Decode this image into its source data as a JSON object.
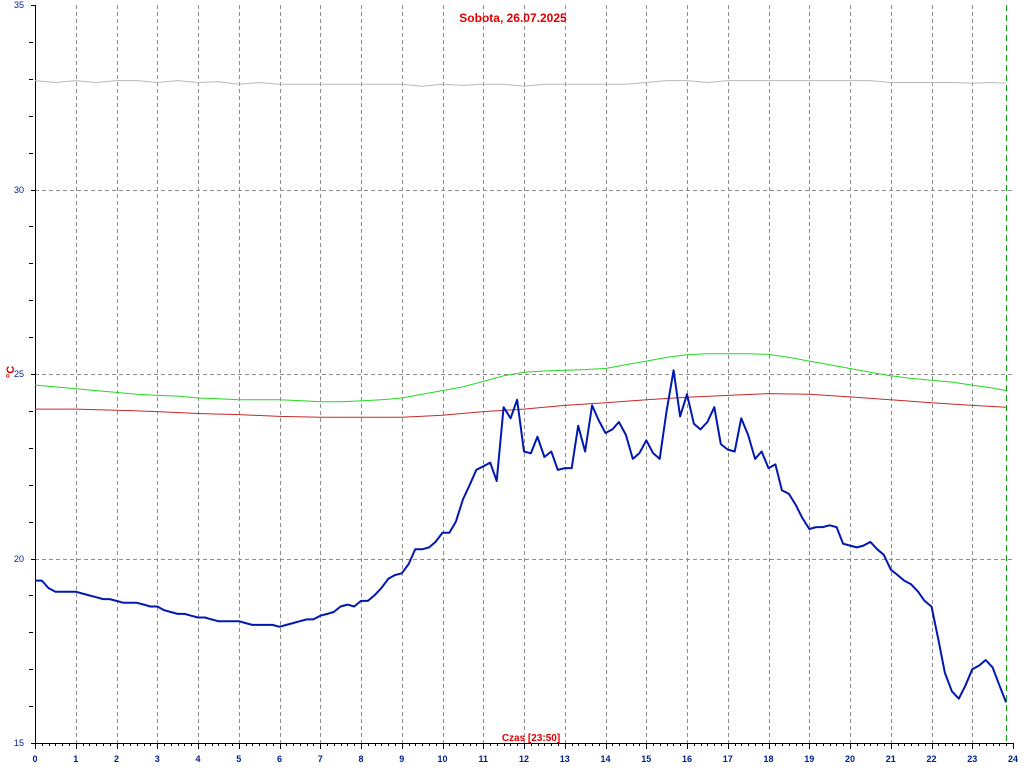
{
  "chart_data": {
    "type": "line",
    "title": "Sobota, 26.07.2025",
    "xlabel": "Czas [23:50]",
    "ylabel": "°C",
    "xlim": [
      0,
      24
    ],
    "ylim": [
      15,
      35
    ],
    "xticks": [
      0,
      1,
      2,
      3,
      4,
      5,
      6,
      7,
      8,
      9,
      10,
      11,
      12,
      13,
      14,
      15,
      16,
      17,
      18,
      19,
      20,
      21,
      22,
      23,
      24
    ],
    "yticks": [
      15,
      20,
      25,
      30,
      35
    ],
    "grid": true,
    "colors": {
      "blue": "#0018b0",
      "green": "#22d822",
      "red": "#c82828",
      "gray": "#b8b8b8",
      "now_line": "#00a000",
      "title": "#e00000",
      "ticks": "#00208a",
      "grid": "#8c8c8c"
    },
    "current_time_hours": 23.83,
    "series": [
      {
        "color": "#0018b0",
        "points": [
          [
            0,
            19.4
          ],
          [
            0.17,
            19.4
          ],
          [
            0.33,
            19.2
          ],
          [
            0.5,
            19.1
          ],
          [
            0.67,
            19.1
          ],
          [
            0.83,
            19.1
          ],
          [
            1,
            19.1
          ],
          [
            1.17,
            19.05
          ],
          [
            1.33,
            19.0
          ],
          [
            1.5,
            18.95
          ],
          [
            1.67,
            18.9
          ],
          [
            1.83,
            18.9
          ],
          [
            2,
            18.85
          ],
          [
            2.17,
            18.8
          ],
          [
            2.33,
            18.8
          ],
          [
            2.5,
            18.8
          ],
          [
            2.67,
            18.75
          ],
          [
            2.83,
            18.7
          ],
          [
            3,
            18.7
          ],
          [
            3.17,
            18.6
          ],
          [
            3.33,
            18.55
          ],
          [
            3.5,
            18.5
          ],
          [
            3.67,
            18.5
          ],
          [
            3.83,
            18.45
          ],
          [
            4,
            18.4
          ],
          [
            4.17,
            18.4
          ],
          [
            4.33,
            18.35
          ],
          [
            4.5,
            18.3
          ],
          [
            4.67,
            18.3
          ],
          [
            4.83,
            18.3
          ],
          [
            5,
            18.3
          ],
          [
            5.17,
            18.25
          ],
          [
            5.33,
            18.2
          ],
          [
            5.5,
            18.2
          ],
          [
            5.67,
            18.2
          ],
          [
            5.83,
            18.2
          ],
          [
            6,
            18.15
          ],
          [
            6.17,
            18.2
          ],
          [
            6.33,
            18.25
          ],
          [
            6.5,
            18.3
          ],
          [
            6.67,
            18.35
          ],
          [
            6.83,
            18.35
          ],
          [
            7,
            18.45
          ],
          [
            7.17,
            18.5
          ],
          [
            7.33,
            18.55
          ],
          [
            7.5,
            18.7
          ],
          [
            7.67,
            18.75
          ],
          [
            7.83,
            18.7
          ],
          [
            8,
            18.85
          ],
          [
            8.17,
            18.85
          ],
          [
            8.33,
            19.0
          ],
          [
            8.5,
            19.2
          ],
          [
            8.67,
            19.45
          ],
          [
            8.83,
            19.55
          ],
          [
            9,
            19.6
          ],
          [
            9.17,
            19.85
          ],
          [
            9.33,
            20.25
          ],
          [
            9.5,
            20.25
          ],
          [
            9.67,
            20.3
          ],
          [
            9.83,
            20.45
          ],
          [
            10,
            20.7
          ],
          [
            10.17,
            20.7
          ],
          [
            10.33,
            21.0
          ],
          [
            10.5,
            21.6
          ],
          [
            10.67,
            22.0
          ],
          [
            10.83,
            22.4
          ],
          [
            11,
            22.5
          ],
          [
            11.17,
            22.6
          ],
          [
            11.33,
            22.1
          ],
          [
            11.5,
            24.1
          ],
          [
            11.67,
            23.8
          ],
          [
            11.83,
            24.3
          ],
          [
            12,
            22.9
          ],
          [
            12.17,
            22.85
          ],
          [
            12.33,
            23.3
          ],
          [
            12.5,
            22.75
          ],
          [
            12.67,
            22.9
          ],
          [
            12.83,
            22.4
          ],
          [
            13,
            22.45
          ],
          [
            13.17,
            22.45
          ],
          [
            13.33,
            23.6
          ],
          [
            13.5,
            22.9
          ],
          [
            13.67,
            24.15
          ],
          [
            13.83,
            23.75
          ],
          [
            14,
            23.4
          ],
          [
            14.17,
            23.5
          ],
          [
            14.33,
            23.7
          ],
          [
            14.5,
            23.35
          ],
          [
            14.67,
            22.7
          ],
          [
            14.83,
            22.85
          ],
          [
            15,
            23.2
          ],
          [
            15.17,
            22.85
          ],
          [
            15.33,
            22.7
          ],
          [
            15.5,
            24.0
          ],
          [
            15.67,
            25.1
          ],
          [
            15.83,
            23.85
          ],
          [
            16,
            24.45
          ],
          [
            16.17,
            23.65
          ],
          [
            16.33,
            23.5
          ],
          [
            16.5,
            23.7
          ],
          [
            16.67,
            24.1
          ],
          [
            16.83,
            23.1
          ],
          [
            17,
            22.95
          ],
          [
            17.17,
            22.9
          ],
          [
            17.33,
            23.8
          ],
          [
            17.5,
            23.35
          ],
          [
            17.67,
            22.7
          ],
          [
            17.83,
            22.9
          ],
          [
            18,
            22.45
          ],
          [
            18.17,
            22.55
          ],
          [
            18.33,
            21.85
          ],
          [
            18.5,
            21.75
          ],
          [
            18.67,
            21.45
          ],
          [
            18.83,
            21.1
          ],
          [
            19,
            20.8
          ],
          [
            19.17,
            20.85
          ],
          [
            19.33,
            20.85
          ],
          [
            19.5,
            20.9
          ],
          [
            19.67,
            20.85
          ],
          [
            19.83,
            20.4
          ],
          [
            20,
            20.35
          ],
          [
            20.17,
            20.3
          ],
          [
            20.33,
            20.35
          ],
          [
            20.5,
            20.45
          ],
          [
            20.67,
            20.25
          ],
          [
            20.83,
            20.1
          ],
          [
            21,
            19.7
          ],
          [
            21.17,
            19.55
          ],
          [
            21.33,
            19.4
          ],
          [
            21.5,
            19.3
          ],
          [
            21.67,
            19.1
          ],
          [
            21.83,
            18.85
          ],
          [
            22,
            18.7
          ],
          [
            22.17,
            17.8
          ],
          [
            22.33,
            16.9
          ],
          [
            22.5,
            16.4
          ],
          [
            22.67,
            16.2
          ],
          [
            22.83,
            16.55
          ],
          [
            23,
            17.0
          ],
          [
            23.17,
            17.1
          ],
          [
            23.33,
            17.25
          ],
          [
            23.5,
            17.05
          ],
          [
            23.67,
            16.55
          ],
          [
            23.83,
            16.1
          ]
        ]
      },
      {
        "color": "#22d822",
        "points": [
          [
            0,
            24.7
          ],
          [
            0.5,
            24.65
          ],
          [
            1,
            24.6
          ],
          [
            1.5,
            24.55
          ],
          [
            2,
            24.5
          ],
          [
            2.5,
            24.45
          ],
          [
            3,
            24.42
          ],
          [
            3.5,
            24.4
          ],
          [
            4,
            24.35
          ],
          [
            4.5,
            24.33
          ],
          [
            5,
            24.3
          ],
          [
            5.5,
            24.3
          ],
          [
            6,
            24.3
          ],
          [
            6.5,
            24.28
          ],
          [
            7,
            24.25
          ],
          [
            7.5,
            24.25
          ],
          [
            8,
            24.27
          ],
          [
            8.5,
            24.3
          ],
          [
            9,
            24.35
          ],
          [
            9.5,
            24.45
          ],
          [
            10,
            24.55
          ],
          [
            10.5,
            24.65
          ],
          [
            11,
            24.8
          ],
          [
            11.5,
            24.95
          ],
          [
            12,
            25.05
          ],
          [
            12.5,
            25.08
          ],
          [
            13,
            25.1
          ],
          [
            13.5,
            25.12
          ],
          [
            14,
            25.15
          ],
          [
            14.5,
            25.25
          ],
          [
            15,
            25.35
          ],
          [
            15.5,
            25.45
          ],
          [
            16,
            25.52
          ],
          [
            16.5,
            25.55
          ],
          [
            17,
            25.55
          ],
          [
            17.5,
            25.55
          ],
          [
            18,
            25.53
          ],
          [
            18.5,
            25.45
          ],
          [
            19,
            25.35
          ],
          [
            19.5,
            25.25
          ],
          [
            20,
            25.15
          ],
          [
            20.5,
            25.05
          ],
          [
            21,
            24.95
          ],
          [
            21.5,
            24.88
          ],
          [
            22,
            24.83
          ],
          [
            22.5,
            24.78
          ],
          [
            23,
            24.7
          ],
          [
            23.5,
            24.62
          ],
          [
            23.83,
            24.55
          ]
        ]
      },
      {
        "color": "#c82828",
        "points": [
          [
            0,
            24.05
          ],
          [
            1,
            24.05
          ],
          [
            2,
            24.02
          ],
          [
            3,
            23.98
          ],
          [
            4,
            23.93
          ],
          [
            5,
            23.9
          ],
          [
            6,
            23.85
          ],
          [
            7,
            23.83
          ],
          [
            8,
            23.83
          ],
          [
            9,
            23.83
          ],
          [
            10,
            23.88
          ],
          [
            11,
            23.98
          ],
          [
            12,
            24.05
          ],
          [
            13,
            24.15
          ],
          [
            14,
            24.22
          ],
          [
            15,
            24.3
          ],
          [
            16,
            24.37
          ],
          [
            17,
            24.42
          ],
          [
            18,
            24.47
          ],
          [
            19,
            24.45
          ],
          [
            20,
            24.38
          ],
          [
            21,
            24.3
          ],
          [
            22,
            24.22
          ],
          [
            23,
            24.15
          ],
          [
            23.83,
            24.1
          ]
        ]
      },
      {
        "color": "#b8b8b8",
        "points": [
          [
            0,
            32.95
          ],
          [
            0.5,
            32.9
          ],
          [
            1,
            32.95
          ],
          [
            1.5,
            32.9
          ],
          [
            2,
            32.95
          ],
          [
            2.5,
            32.95
          ],
          [
            3,
            32.9
          ],
          [
            3.5,
            32.95
          ],
          [
            4,
            32.9
          ],
          [
            4.5,
            32.92
          ],
          [
            5,
            32.85
          ],
          [
            5.5,
            32.9
          ],
          [
            6,
            32.85
          ],
          [
            6.5,
            32.85
          ],
          [
            7,
            32.85
          ],
          [
            7.5,
            32.85
          ],
          [
            8,
            32.85
          ],
          [
            8.5,
            32.85
          ],
          [
            9,
            32.85
          ],
          [
            9.5,
            32.8
          ],
          [
            10,
            32.85
          ],
          [
            10.5,
            32.82
          ],
          [
            11,
            32.85
          ],
          [
            11.5,
            32.85
          ],
          [
            12,
            32.8
          ],
          [
            12.5,
            32.85
          ],
          [
            13,
            32.85
          ],
          [
            13.5,
            32.85
          ],
          [
            14,
            32.85
          ],
          [
            14.5,
            32.85
          ],
          [
            15,
            32.9
          ],
          [
            15.5,
            32.95
          ],
          [
            16,
            32.95
          ],
          [
            16.5,
            32.9
          ],
          [
            17,
            32.95
          ],
          [
            17.5,
            32.95
          ],
          [
            18,
            32.95
          ],
          [
            18.5,
            32.95
          ],
          [
            19,
            32.95
          ],
          [
            19.5,
            32.95
          ],
          [
            20,
            32.95
          ],
          [
            20.5,
            32.95
          ],
          [
            21,
            32.9
          ],
          [
            21.5,
            32.9
          ],
          [
            22,
            32.9
          ],
          [
            22.5,
            32.9
          ],
          [
            23,
            32.88
          ],
          [
            23.5,
            32.9
          ],
          [
            23.83,
            32.88
          ]
        ]
      }
    ]
  }
}
